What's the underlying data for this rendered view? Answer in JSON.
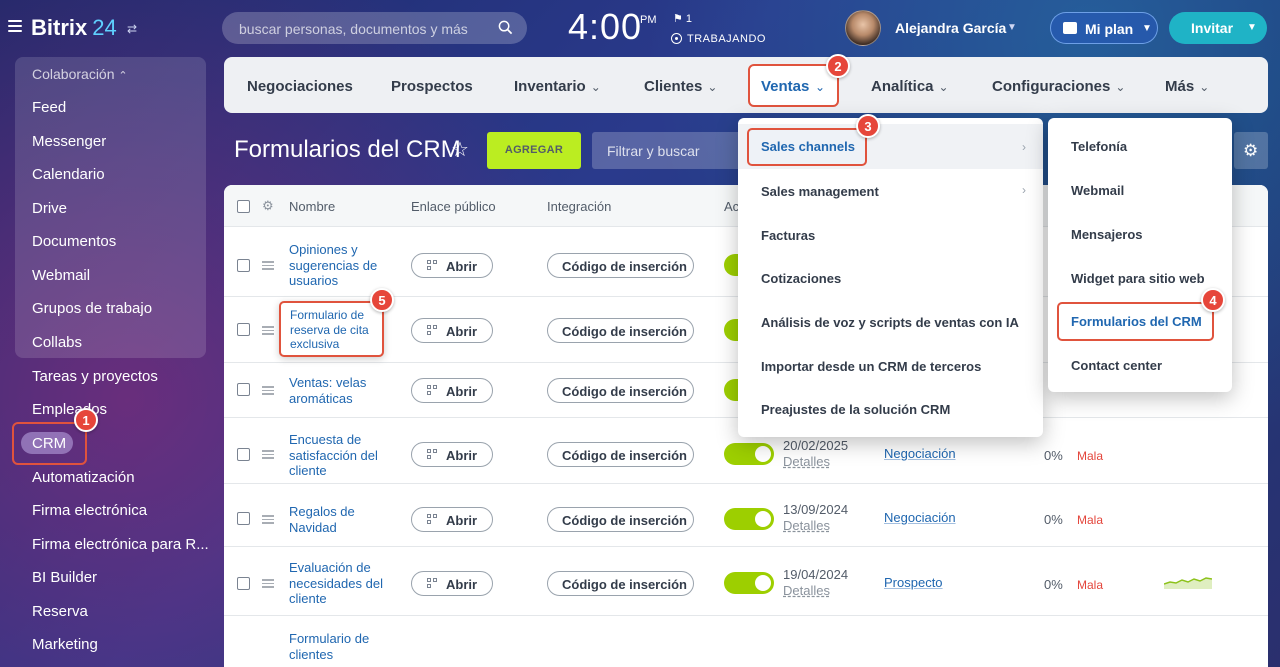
{
  "topbar": {
    "logo_text": "Bitrix",
    "logo_num": "24",
    "search_placeholder": "buscar personas, documentos y más",
    "clock": "4:00",
    "clock_suffix": "PM",
    "flag_count": "1",
    "work_status": "TRABAJANDO",
    "user_name": "Alejandra García",
    "plan_label": "Mi plan",
    "invite_label": "Invitar"
  },
  "sidebar": {
    "group_title": "Colaboración",
    "items": [
      "Feed",
      "Messenger",
      "Calendario",
      "Drive",
      "Documentos",
      "Webmail",
      "Grupos de trabajo",
      "Collabs"
    ],
    "below": [
      "Tareas y proyectos",
      "Empleados",
      "CRM",
      "Automatización",
      "Firma electrónica",
      "Firma electrónica para R...",
      "BI Builder",
      "Reserva",
      "Marketing"
    ]
  },
  "tabs": [
    "Negociaciones",
    "Prospectos",
    "Inventario",
    "Clientes",
    "Ventas",
    "Analítica",
    "Configuraciones",
    "Más"
  ],
  "page": {
    "title": "Formularios del CRM",
    "add_label": "AGREGAR",
    "filter_placeholder": "Filtrar y buscar"
  },
  "table": {
    "headers": [
      "Nombre",
      "Enlace público",
      "Integración",
      "Ac"
    ],
    "open_label": "Abrir",
    "embed_label": "Código de inserción",
    "details_label": "Detalles",
    "bad_label": "Mala",
    "rows": [
      {
        "name": "Opiniones y sugerencias de usuarios",
        "date": "",
        "stage": "",
        "pct": ""
      },
      {
        "name": "Formulario de reserva de cita exclusiva",
        "date": "",
        "stage": "",
        "pct": ""
      },
      {
        "name": "Ventas: velas aromáticas",
        "date": "",
        "stage": "",
        "pct": ""
      },
      {
        "name": "Encuesta de satisfacción del cliente",
        "date": "20/02/2025",
        "stage": "Negociación",
        "pct": "0%"
      },
      {
        "name": "Regalos de Navidad",
        "date": "13/09/2024",
        "stage": "Negociación",
        "pct": "0%"
      },
      {
        "name": "Evaluación de necesidades del cliente",
        "date": "19/04/2024",
        "stage": "Prospecto",
        "pct": "0%"
      },
      {
        "name": "Formulario de clientes",
        "date": "",
        "stage": "",
        "pct": ""
      }
    ]
  },
  "menu_ventas": [
    "Sales channels",
    "Sales management",
    "Facturas",
    "Cotizaciones",
    "Análisis de voz y scripts de ventas con IA",
    "Importar desde un CRM de terceros",
    "Preajustes de la solución CRM"
  ],
  "menu_channels": [
    "Telefonía",
    "Webmail",
    "Mensajeros",
    "Widget para sitio web",
    "Formularios del CRM",
    "Contact center"
  ],
  "callouts": [
    "1",
    "2",
    "3",
    "4",
    "5"
  ],
  "colors": {
    "accent": "#2067b0",
    "highlight": "#e0533d",
    "add_button": "#bbed21",
    "toggle_on": "#9dcf00"
  }
}
